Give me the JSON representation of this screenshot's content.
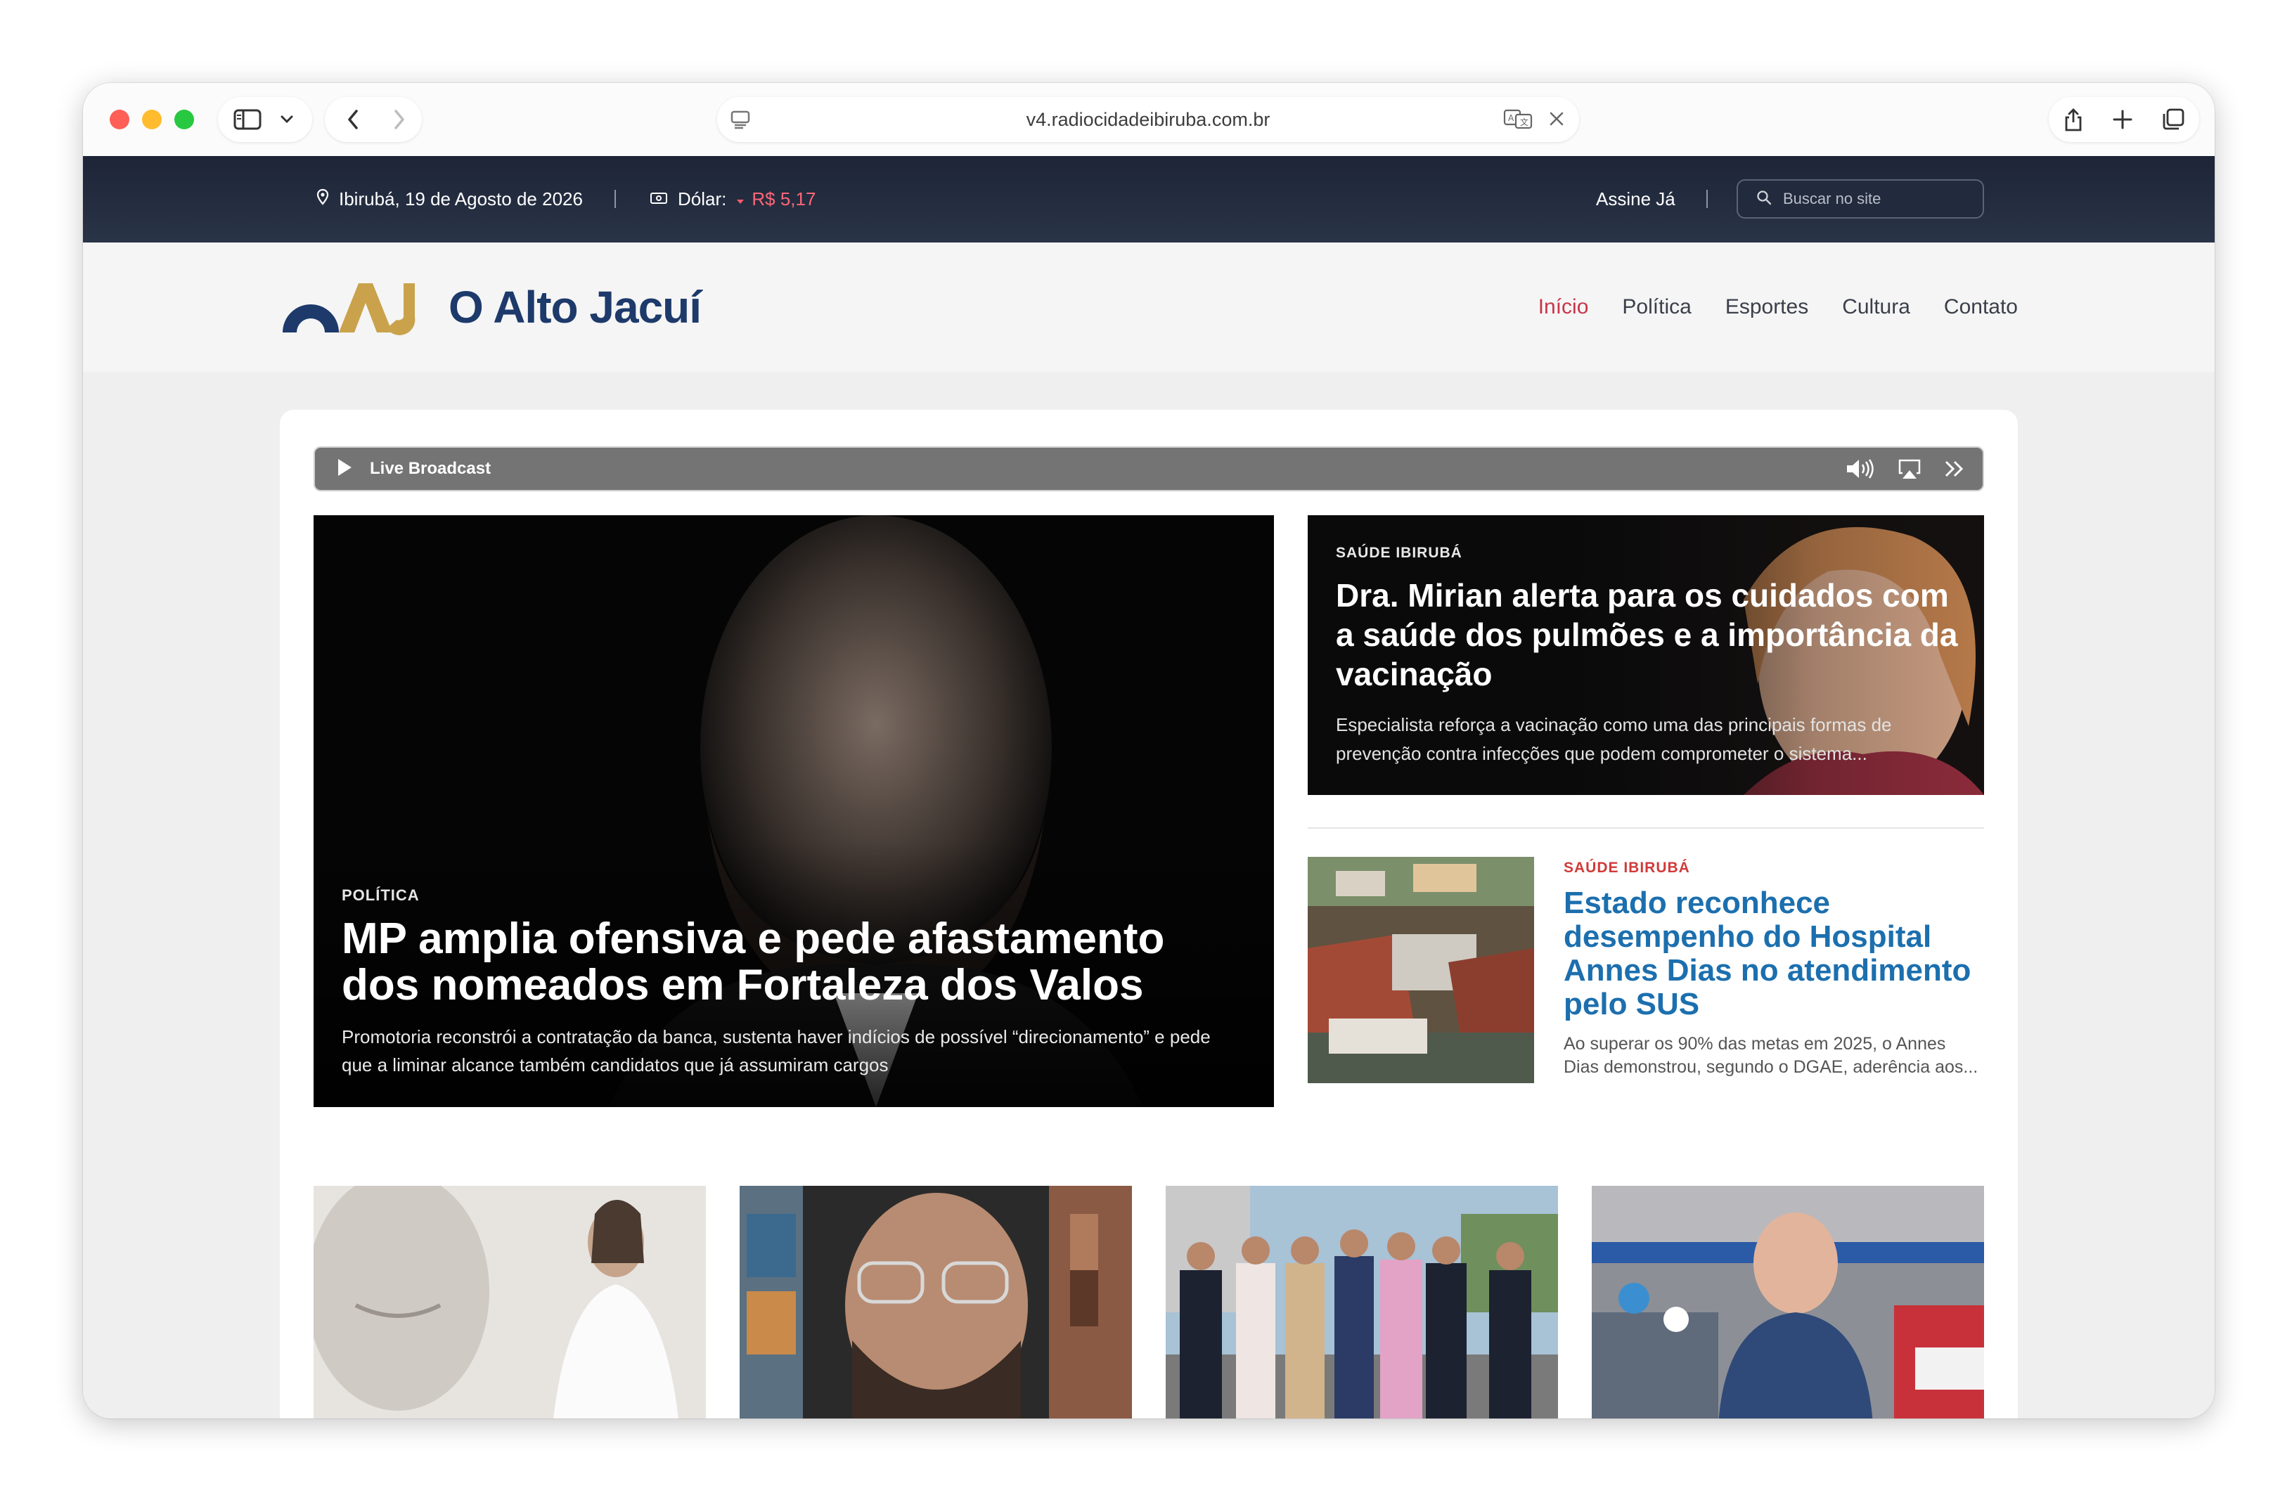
{
  "browser": {
    "url": "v4.radiocidadeibiruba.com.br"
  },
  "topbar": {
    "location_date": "Ibirubá, 19 de Agosto de 2026",
    "dollar_label": "Dólar:",
    "dollar_value": "R$ 5,17",
    "subscribe": "Assine Já",
    "search_placeholder": "Buscar no site"
  },
  "header": {
    "logo_mark": "OAJ",
    "logo_text": "O Alto Jacuí",
    "nav": [
      {
        "label": "Início",
        "active": true
      },
      {
        "label": "Política"
      },
      {
        "label": "Esportes"
      },
      {
        "label": "Cultura"
      },
      {
        "label": "Contato"
      }
    ]
  },
  "player": {
    "label": "Live Broadcast"
  },
  "hero": {
    "category": "POLÍTICA",
    "title": "MP amplia ofensiva e pede afastamento dos nomeados em Fortaleza dos Valos",
    "description": "Promotoria reconstrói a contratação da banca, sustenta haver indícios de possível “direcionamento” e pede que a liminar alcance também candidatos que já assumiram cargos"
  },
  "side_story_1": {
    "category": "SAÚDE IBIRUBÁ",
    "title": "Dra. Mirian alerta para os cuidados com a saúde dos pulmões e a importância da vacinação",
    "description": "Especialista reforça a vacinação como uma das principais formas de prevenção contra infecções que podem comprometer o sistema..."
  },
  "side_story_2": {
    "category": "SAÚDE IBIRUBÁ",
    "title": "Estado reconhece desempenho do Hospital Annes Dias no atendimento pelo SUS",
    "description": "Ao superar os 90% das metas em 2025, o Annes Dias demonstrou, segundo o DGAE, aderência aos..."
  },
  "colors": {
    "accent_red": "#c8354a",
    "link_blue": "#1c6fae",
    "topbar_dark": "#1d2537"
  }
}
